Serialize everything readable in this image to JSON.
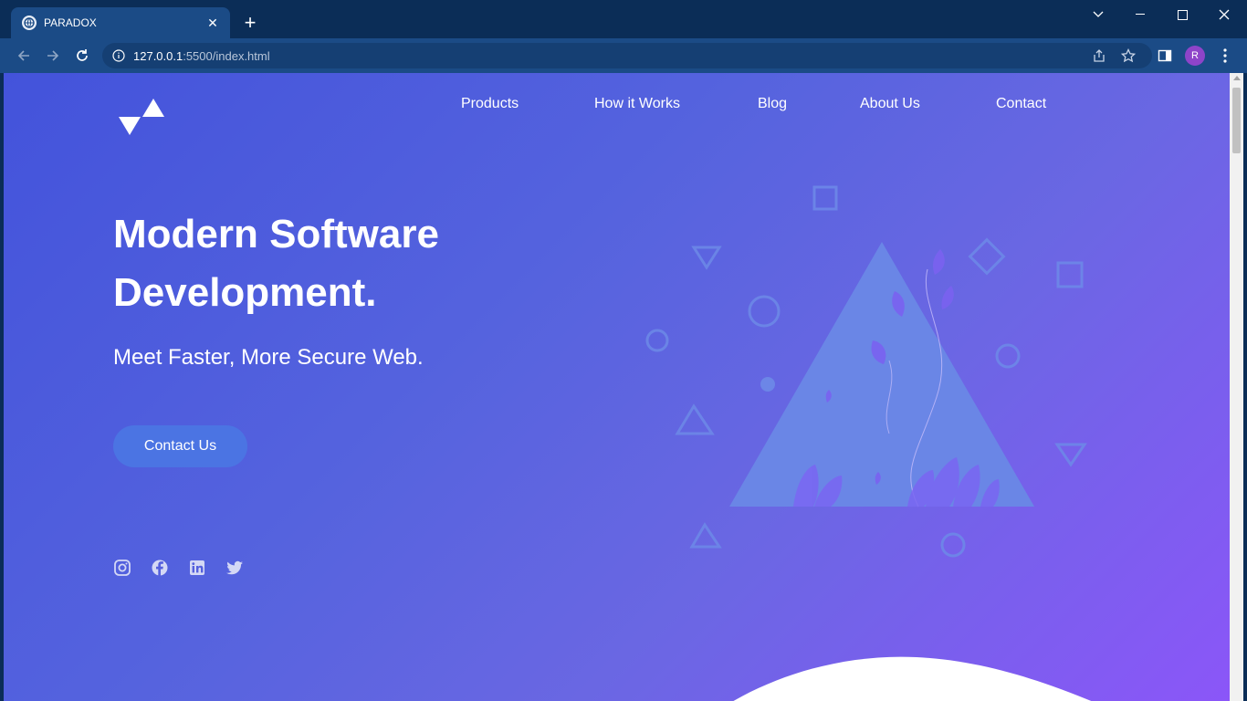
{
  "browser": {
    "tab_title": "PARADOX",
    "url_host": "127.0.0.1",
    "url_path": ":5500/index.html",
    "profile_initial": "R"
  },
  "site": {
    "nav": [
      "Products",
      "How it Works",
      "Blog",
      "About Us",
      "Contact"
    ],
    "hero": {
      "title": "Modern Software Development.",
      "subtitle": "Meet Faster, More Secure Web.",
      "cta": "Contact Us"
    },
    "socials": [
      "instagram-icon",
      "facebook-icon",
      "linkedin-icon",
      "twitter-icon"
    ],
    "colors": {
      "gradient_start": "#4353db",
      "gradient_end": "#8b56f8",
      "cta_bg": "#4b74e3",
      "chrome_dark": "#0b2d57",
      "chrome_toolbar": "#1b4b86"
    }
  }
}
